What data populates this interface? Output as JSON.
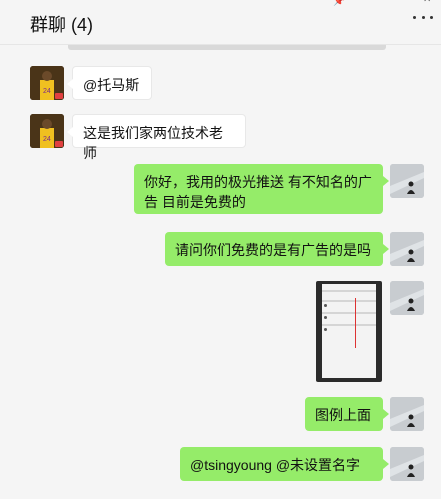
{
  "header": {
    "title": "群聊 (4)",
    "more_label": "···"
  },
  "window_controls": {
    "pin": "📌",
    "minimize": "—",
    "close": "✕"
  },
  "messages": [
    {
      "side": "left",
      "text": "@托马斯"
    },
    {
      "side": "left",
      "text": "这是我们家两位技术老师"
    },
    {
      "side": "right",
      "text": "你好，我用的极光推送 有不知名的广告 目前是免费的"
    },
    {
      "side": "right",
      "text": "请问你们免费的是有广告的是吗"
    },
    {
      "side": "right",
      "type": "image",
      "alt": "screenshot"
    },
    {
      "side": "right",
      "text": "图例上面"
    },
    {
      "side": "right",
      "text": "@tsingyoung @未设置名字"
    }
  ],
  "colors": {
    "bubble_self": "#95ec69",
    "bubble_other": "#ffffff",
    "background": "#f5f5f5"
  }
}
